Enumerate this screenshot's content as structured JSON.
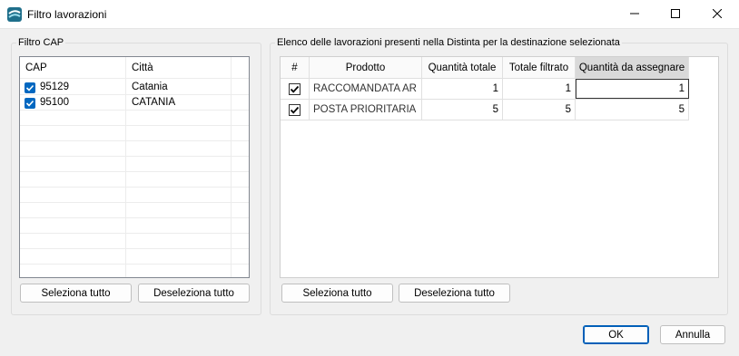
{
  "window": {
    "title": "Filtro lavorazioni",
    "minimize_glyph": "—",
    "maximize_glyph": "☐",
    "close_glyph": "✕"
  },
  "cap_filter": {
    "label": "Filtro CAP",
    "columns": [
      "CAP",
      "Città"
    ],
    "rows": [
      {
        "cap": "95129",
        "city": "Catania",
        "checked": true
      },
      {
        "cap": "95100",
        "city": "CATANIA",
        "checked": true
      }
    ],
    "select_all": "Seleziona tutto",
    "deselect_all": "Deseleziona tutto"
  },
  "lavorazioni": {
    "label": "Elenco delle lavorazioni presenti nella Distinta per la destinazione selezionata",
    "columns": [
      "#",
      "Prodotto",
      "Quantità totale",
      "Totale filtrato",
      "Quantità da assegnare"
    ],
    "rows": [
      {
        "checked": true,
        "prodotto": "RACCOMANDATA AR",
        "totale": "1",
        "filtrato": "1",
        "assegnare": "1"
      },
      {
        "checked": true,
        "prodotto": "POSTA PRIORITARIA",
        "totale": "5",
        "filtrato": "5",
        "assegnare": "5"
      }
    ],
    "select_all": "Seleziona tutto",
    "deselect_all": "Deseleziona tutto"
  },
  "footer": {
    "ok": "OK",
    "cancel": "Annulla"
  },
  "icons": {
    "app": "app-logo-icon",
    "check": "✔"
  },
  "colors": {
    "accent": "#0067c0",
    "selected_header": "#d9d9d9"
  }
}
